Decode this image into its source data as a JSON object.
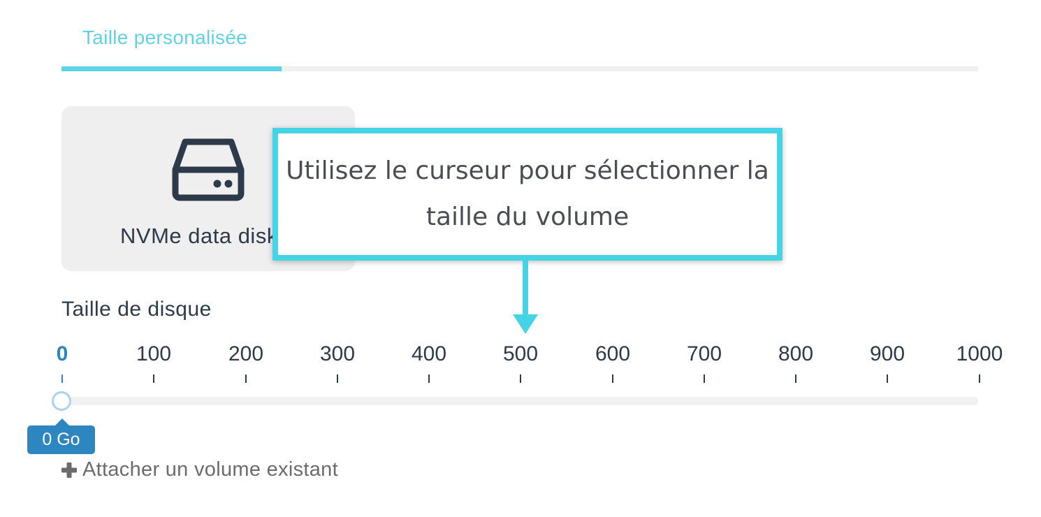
{
  "tabs": [
    {
      "label": "Taille personalisée",
      "active": true
    }
  ],
  "colors": {
    "accent": "#5fd3e6",
    "callout_border": "#45d4e6",
    "primary_blue": "#2e86c1",
    "text_dark": "#2d3a4a",
    "card_bg": "#efefef"
  },
  "disk_card": {
    "icon": "hard-drive-icon",
    "label": "NVMe data disk"
  },
  "callout": {
    "text": "Utilisez le curseur pour sélectionner la taille du volume",
    "arrow_icon": "arrow-down-icon"
  },
  "slider": {
    "label": "Taille de disque",
    "ticks": [
      "0",
      "100",
      "200",
      "300",
      "400",
      "500",
      "600",
      "700",
      "800",
      "900",
      "1000"
    ],
    "min": 0,
    "max": 1000,
    "value": 0,
    "value_display": "0 Go"
  },
  "attach": {
    "icon": "plus-icon",
    "label": "Attacher un volume existant"
  }
}
